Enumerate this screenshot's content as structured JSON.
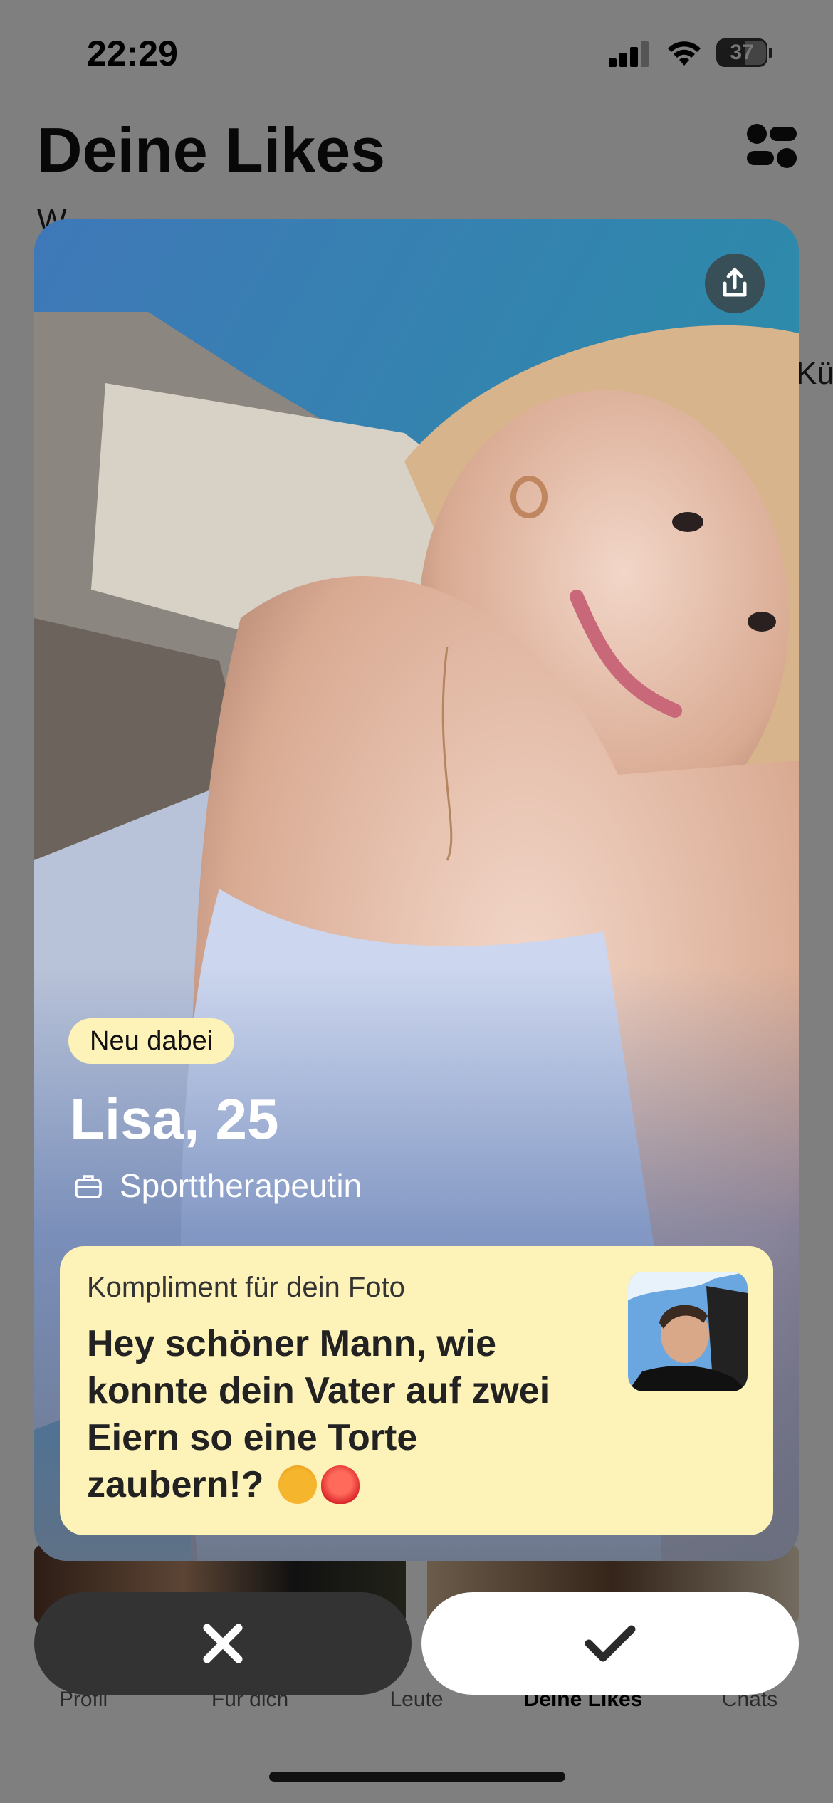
{
  "status_bar": {
    "time": "22:29",
    "battery": "37"
  },
  "header": {
    "title": "Deine Likes",
    "subtitle_fragment": "W",
    "right_peek_text": "Kü",
    "filter_icon": "filter-settings-icon"
  },
  "tabs": [
    {
      "label": "Profil",
      "active": false
    },
    {
      "label": "Für dich",
      "active": false
    },
    {
      "label": "Leute",
      "active": false
    },
    {
      "label": "Deine Likes",
      "active": true
    },
    {
      "label": "Chats",
      "active": false
    }
  ],
  "profile_card": {
    "badge": "Neu dabei",
    "name_age": "Lisa, 25",
    "job": "Sporttherapeutin",
    "job_icon": "briefcase-icon",
    "share_icon": "share-icon",
    "compliment": {
      "label": "Kompliment für dein Foto",
      "text": "Hey schöner Mann, wie konnte dein Vater auf zwei Eiern so eine Torte zaubern!?",
      "emojis": [
        "exploding-head-emoji",
        "heart-on-fire-emoji"
      ]
    }
  },
  "actions": {
    "pass_icon": "close-x-icon",
    "like_icon": "checkmark-icon"
  },
  "colors": {
    "badge_bg": "#fdf2b8",
    "card_bg": "#4a6ea8",
    "pass_button": "#333333",
    "like_button": "#ffffff"
  }
}
